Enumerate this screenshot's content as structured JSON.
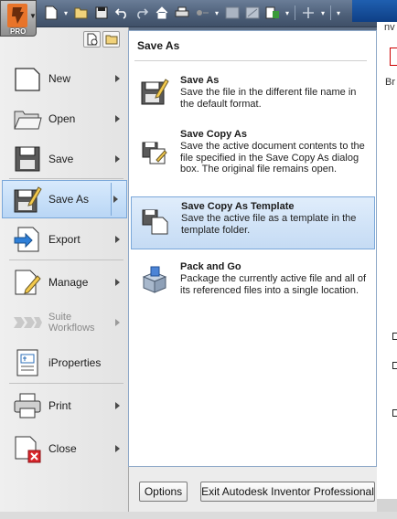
{
  "app": {
    "badge": "PRO",
    "background_tab_text": "nv",
    "background_partial_text": "Br"
  },
  "quick_access_toolbar": {
    "icons": [
      "new-icon",
      "open-icon",
      "save-icon",
      "undo-icon",
      "redo-icon",
      "home-icon",
      "print-icon",
      "sketch-icon",
      "color-icon",
      "parameters-icon",
      "select-icon",
      "plus-icon"
    ]
  },
  "left_menu": {
    "items": [
      {
        "label": "New",
        "icon": "new-document-icon",
        "has_arrow": true
      },
      {
        "label": "Open",
        "icon": "open-folder-icon",
        "has_arrow": true
      },
      {
        "label": "Save",
        "icon": "save-icon",
        "has_arrow": true
      },
      {
        "label": "Save As",
        "icon": "save-as-icon",
        "has_arrow": true,
        "active": true
      },
      {
        "label": "Export",
        "icon": "export-icon",
        "has_arrow": true
      },
      {
        "label": "Manage",
        "icon": "manage-icon",
        "has_arrow": true
      },
      {
        "label": "Suite",
        "label2": "Workflows",
        "icon": "suite-workflows-icon",
        "has_arrow": true,
        "disabled": true
      },
      {
        "label": "iProperties",
        "icon": "iproperties-icon",
        "has_arrow": false
      },
      {
        "label": "Print",
        "icon": "print-icon",
        "has_arrow": true
      },
      {
        "label": "Close",
        "icon": "close-document-icon",
        "has_arrow": true
      }
    ]
  },
  "submenu": {
    "title": "Save As",
    "options": [
      {
        "title": "Save As",
        "description": "Save the file in the different file name in the default format.",
        "icon": "save-as-pencil-icon"
      },
      {
        "title": "Save Copy As",
        "description": "Save the active document contents to the file specified in the Save Copy As dialog box. The original file remains open.",
        "icon": "save-copy-as-icon"
      },
      {
        "title": "Save Copy As Template",
        "description": "Save the active file as a template in the template folder.",
        "icon": "save-template-icon",
        "active": true
      },
      {
        "title": "Pack and Go",
        "description": "Package the currently active file and all of its referenced files into a single location.",
        "icon": "pack-and-go-icon"
      }
    ]
  },
  "footer": {
    "options_label": "Options",
    "exit_label": "Exit Autodesk Inventor Professional"
  },
  "colors": {
    "highlight": "#c5dbf4",
    "highlight_border": "#7aa7d9",
    "titlebar": "#4c5e77"
  }
}
